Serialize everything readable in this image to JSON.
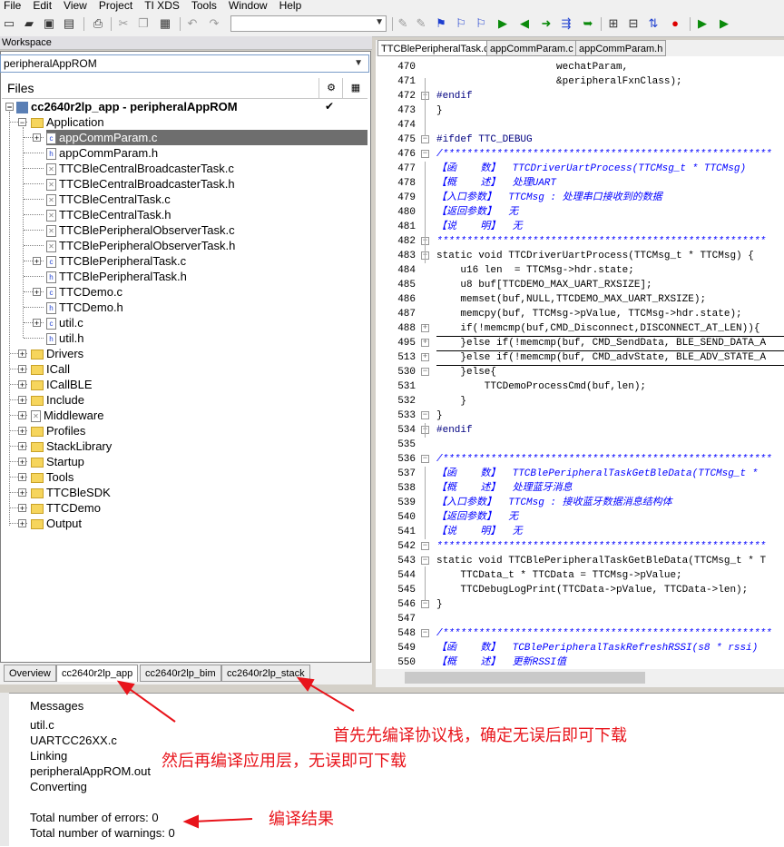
{
  "menu": [
    "File",
    "Edit",
    "View",
    "Project",
    "TI XDS",
    "Tools",
    "Window",
    "Help"
  ],
  "workspace": {
    "title": "Workspace",
    "config": "peripheralAppROM",
    "files_header": "Files",
    "project": "cc2640r2lp_app - peripheralAppROM",
    "project_check": "✔",
    "tree": [
      {
        "label": "Application",
        "type": "folder"
      },
      {
        "label": "appCommParam.c",
        "type": "c",
        "selected": true
      },
      {
        "label": "appCommParam.h",
        "type": "h"
      },
      {
        "label": "TTCBleCentralBroadcasterTask.c",
        "type": "x"
      },
      {
        "label": "TTCBleCentralBroadcasterTask.h",
        "type": "x"
      },
      {
        "label": "TTCBleCentralTask.c",
        "type": "x"
      },
      {
        "label": "TTCBleCentralTask.h",
        "type": "x"
      },
      {
        "label": "TTCBlePeripheralObserverTask.c",
        "type": "x"
      },
      {
        "label": "TTCBlePeripheralObserverTask.h",
        "type": "x"
      },
      {
        "label": "TTCBlePeripheralTask.c",
        "type": "c"
      },
      {
        "label": "TTCBlePeripheralTask.h",
        "type": "h"
      },
      {
        "label": "TTCDemo.c",
        "type": "c"
      },
      {
        "label": "TTCDemo.h",
        "type": "h"
      },
      {
        "label": "util.c",
        "type": "c"
      },
      {
        "label": "util.h",
        "type": "h"
      },
      {
        "label": "Drivers",
        "type": "folder"
      },
      {
        "label": "ICall",
        "type": "folder"
      },
      {
        "label": "ICallBLE",
        "type": "folder"
      },
      {
        "label": "Include",
        "type": "folder"
      },
      {
        "label": "Middleware",
        "type": "xfolder"
      },
      {
        "label": "Profiles",
        "type": "folder"
      },
      {
        "label": "StackLibrary",
        "type": "folder"
      },
      {
        "label": "Startup",
        "type": "folder"
      },
      {
        "label": "Tools",
        "type": "folder"
      },
      {
        "label": "TTCBleSDK",
        "type": "folder"
      },
      {
        "label": "TTCDemo",
        "type": "folder"
      },
      {
        "label": "Output",
        "type": "folder"
      }
    ],
    "bottom_tabs": [
      "Overview",
      "cc2640r2lp_app",
      "cc2640r2lp_bim",
      "cc2640r2lp_stack"
    ]
  },
  "editor": {
    "tabs": [
      "TTCBlePeripheralTask.c",
      "appCommParam.c",
      "appCommParam.h"
    ],
    "lines": [
      {
        "n": "470",
        "t": "                    wechatParam,"
      },
      {
        "n": "471",
        "t": "                    &peripheralFxnClass);"
      },
      {
        "n": "472",
        "t": "#endif"
      },
      {
        "n": "473",
        "t": "}"
      },
      {
        "n": "474",
        "t": ""
      },
      {
        "n": "475",
        "t": "#ifdef TTC_DEBUG"
      },
      {
        "n": "476",
        "t": "/*******************************************************"
      },
      {
        "n": "477",
        "t": "【函    数】  TTCDriverUartProcess(TTCMsg_t * TTCMsg)"
      },
      {
        "n": "478",
        "t": "【概    述】  处理UART"
      },
      {
        "n": "479",
        "t": "【入口参数】  TTCMsg : 处理串口接收到的数据"
      },
      {
        "n": "480",
        "t": "【返回参数】  无"
      },
      {
        "n": "481",
        "t": "【说    明】  无"
      },
      {
        "n": "482",
        "t": "*******************************************************"
      },
      {
        "n": "483",
        "t": "static void TTCDriverUartProcess(TTCMsg_t * TTCMsg) {"
      },
      {
        "n": "484",
        "t": "    u16 len  = TTCMsg->hdr.state;"
      },
      {
        "n": "485",
        "t": "    u8 buf[TTCDEMO_MAX_UART_RXSIZE];"
      },
      {
        "n": "486",
        "t": "    memset(buf,NULL,TTCDEMO_MAX_UART_RXSIZE);"
      },
      {
        "n": "487",
        "t": "    memcpy(buf, TTCMsg->pValue, TTCMsg->hdr.state);"
      },
      {
        "n": "488",
        "t": "    if(!memcmp(buf,CMD_Disconnect,DISCONNECT_AT_LEN)){"
      },
      {
        "n": "495",
        "t": "    }else if(!memcmp(buf, CMD_SendData, BLE_SEND_DATA_A"
      },
      {
        "n": "513",
        "t": "    }else if(!memcmp(buf, CMD_advState, BLE_ADV_STATE_A"
      },
      {
        "n": "530",
        "t": "    }else{"
      },
      {
        "n": "531",
        "t": "        TTCDemoProcessCmd(buf,len);"
      },
      {
        "n": "532",
        "t": "    }"
      },
      {
        "n": "533",
        "t": "}"
      },
      {
        "n": "534",
        "t": "#endif"
      },
      {
        "n": "535",
        "t": ""
      },
      {
        "n": "536",
        "t": "/*******************************************************"
      },
      {
        "n": "537",
        "t": "【函    数】  TTCBlePeripheralTaskGetBleData(TTCMsg_t *"
      },
      {
        "n": "538",
        "t": "【概    述】  处理蓝牙消息"
      },
      {
        "n": "539",
        "t": "【入口参数】  TTCMsg : 接收蓝牙数据消息结构体"
      },
      {
        "n": "540",
        "t": "【返回参数】  无"
      },
      {
        "n": "541",
        "t": "【说    明】  无"
      },
      {
        "n": "542",
        "t": "*******************************************************"
      },
      {
        "n": "543",
        "t": "static void TTCBlePeripheralTaskGetBleData(TTCMsg_t * T"
      },
      {
        "n": "544",
        "t": "    TTCData_t * TTCData = TTCMsg->pValue;"
      },
      {
        "n": "545",
        "t": "    TTCDebugLogPrint(TTCData->pValue, TTCData->len);"
      },
      {
        "n": "546",
        "t": "}"
      },
      {
        "n": "547",
        "t": ""
      },
      {
        "n": "548",
        "t": "/*******************************************************"
      },
      {
        "n": "549",
        "t": "【函    数】  TCBlePeripheralTaskRefreshRSSI(s8 * rssi)"
      },
      {
        "n": "550",
        "t": "【概    述】  更新RSSI值"
      }
    ]
  },
  "messages": {
    "header": "Messages",
    "lines": [
      "util.c",
      "UARTCC26XX.c",
      "Linking",
      "peripheralAppROM.out",
      "Converting",
      "",
      "Total number of errors: 0",
      "Total number of warnings: 0"
    ]
  },
  "annotations": {
    "stack": "首先先编译协议栈，确定无误后即可下载",
    "app": "然后再编译应用层，无误即可下载",
    "result": "编译结果"
  },
  "colors": {
    "annotation": "#e8141b",
    "comment": "#0000ff",
    "keyword": "#000080"
  }
}
